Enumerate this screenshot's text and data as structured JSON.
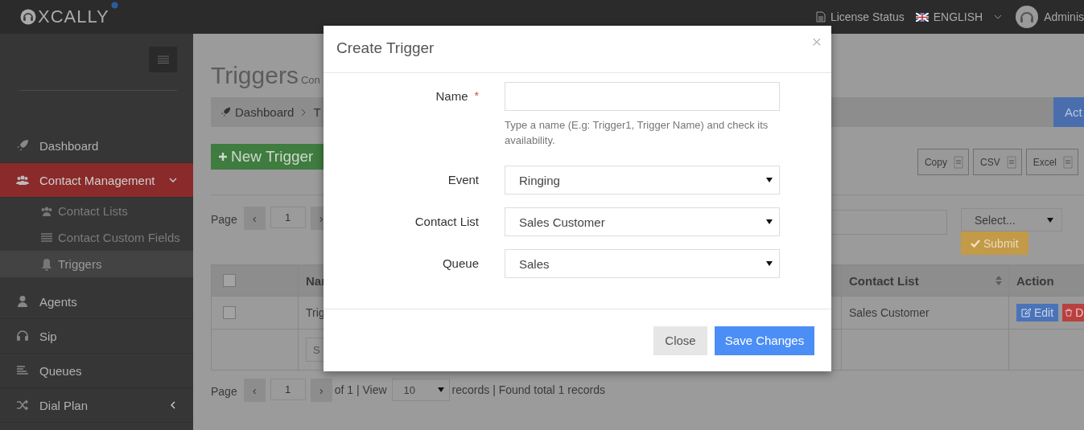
{
  "header": {
    "logo": "XCALLY",
    "license_status": "License Status",
    "language": "ENGLISH",
    "user": "Adminis"
  },
  "sidebar": {
    "items": [
      {
        "label": "Dashboard",
        "kind": "link",
        "selected": false
      },
      {
        "label": "Contact Management",
        "kind": "group",
        "selected": true,
        "expanded": true,
        "children": [
          {
            "label": "Contact Lists",
            "selected": false
          },
          {
            "label": "Contact Custom Fields",
            "selected": false
          },
          {
            "label": "Triggers",
            "selected": true
          }
        ]
      },
      {
        "label": "Agents",
        "kind": "link",
        "selected": false
      },
      {
        "label": "Sip",
        "kind": "link",
        "selected": false
      },
      {
        "label": "Queues",
        "kind": "link",
        "selected": false
      },
      {
        "label": "Dial Plan",
        "kind": "group",
        "selected": false,
        "expanded": false
      }
    ]
  },
  "page": {
    "title": "Triggers",
    "subtitle": "Con",
    "breadcrumb": [
      "Dashboard",
      "T"
    ],
    "actions_button": "Act",
    "new_button": "New Trigger",
    "export_buttons": [
      "Copy",
      "CSV",
      "Excel"
    ],
    "pager_top": {
      "label": "Page",
      "prev": "‹",
      "page": "1",
      "next": "›"
    },
    "filter": {
      "select": "Select...",
      "submit": "Submit"
    },
    "table": {
      "header_checked": false,
      "columns": [
        "Nar",
        "Contact List",
        "Action"
      ],
      "rows": [
        {
          "checked": false,
          "name": "Trig",
          "contact_list": "Sales Customer",
          "actions": [
            "Edit",
            "D"
          ]
        }
      ],
      "filter_placeholder": "S"
    },
    "pager_bottom": {
      "label": "Page",
      "prev": "‹",
      "page": "1",
      "next": "›",
      "of": "of 1 | View",
      "view": "10",
      "records": "records | Found total 1 records"
    }
  },
  "modal": {
    "title": "Create Trigger",
    "close": "×",
    "fields": [
      {
        "label": "Name",
        "kind": "text",
        "required_mark": "*",
        "help": "Type a name (E.g: Trigger1, Trigger Name) and check its availability."
      },
      {
        "label": "Event",
        "kind": "select",
        "value": "Ringing"
      },
      {
        "label": "Contact List",
        "kind": "select",
        "value": "Sales Customer"
      },
      {
        "label": "Queue",
        "kind": "select",
        "value": "Sales"
      }
    ],
    "buttons": [
      "Close",
      "Save Changes"
    ]
  }
}
